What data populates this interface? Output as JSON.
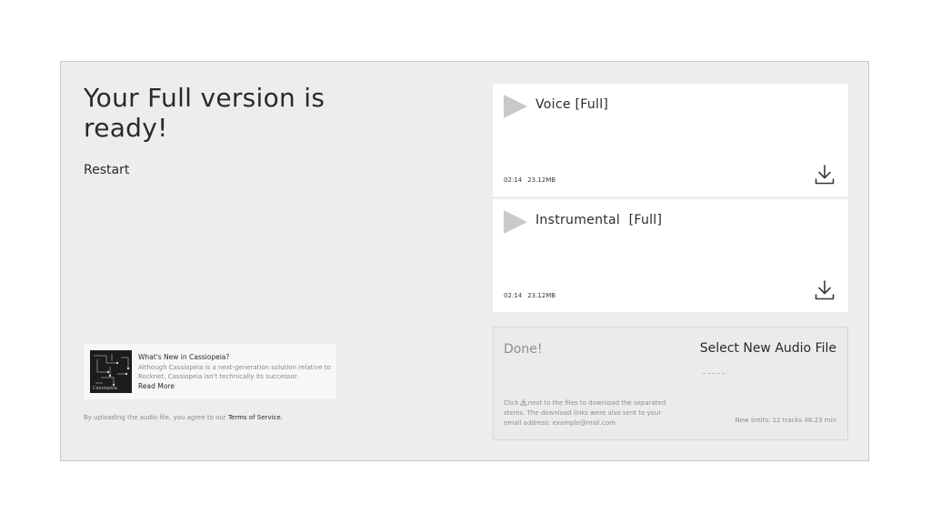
{
  "headline": "Your Full version is ready!",
  "restart_label": "Restart",
  "news": {
    "title": "What's New in Cassiopeia?",
    "body": "Although Cassiopeia is a next-generation solution relative to Rocknet, Cassiopeia isn't technically its successor.",
    "link_label": "Read More",
    "thumb_label": "Cassiopeia"
  },
  "terms": {
    "prefix": "By uploading the audio file, you agree to our ",
    "link_label": "Terms of Service."
  },
  "tracks": [
    {
      "name": "Voice [Full]",
      "duration": "02:14",
      "size": "23.12MB",
      "icon": "play-icon",
      "download_icon": "download-icon"
    },
    {
      "name": "Instrumental  [Full]",
      "duration": "02:14",
      "size": "23.12MB",
      "icon": "play-icon",
      "download_icon": "download-icon"
    }
  ],
  "status": {
    "done_label": "Done!",
    "new_file_label": "Select New Audio File",
    "info_pre": "Click",
    "info_post": "next to the files to download the separated stems. The download links were also sent to your email address: example@mail.com",
    "limits": "New limits: 12 tracks 48:23 min"
  },
  "colors": {
    "panel_bg": "#ededed",
    "card_bg": "#ffffff",
    "play_icon": "#c9c9c9",
    "muted_text": "#8e8e8e"
  }
}
